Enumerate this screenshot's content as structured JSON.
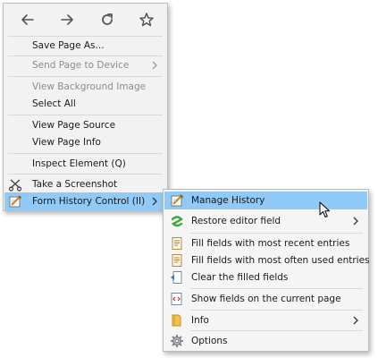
{
  "nav": {
    "back_icon": "arrow-left-icon",
    "forward_icon": "arrow-right-icon",
    "reload_icon": "reload-icon",
    "bookmark_icon": "star-icon"
  },
  "main_menu": {
    "save_page_as": "Save Page As...",
    "send_page_to_device": "Send Page to Device",
    "view_background_image": "View Background Image",
    "select_all": "Select All",
    "view_page_source": "View Page Source",
    "view_page_info": "View Page Info",
    "inspect_element": "Inspect Element (Q)",
    "take_screenshot": "Take a Screenshot",
    "form_history_control": "Form History Control (II)"
  },
  "sub_menu": {
    "manage_history": "Manage History",
    "restore_editor_field": "Restore editor field",
    "fill_recent": "Fill fields with most recent entries",
    "fill_often": "Fill fields with most often used entries",
    "clear_filled": "Clear the filled fields",
    "show_fields": "Show fields on the current page",
    "info": "Info",
    "options": "Options"
  },
  "colors": {
    "menu_bg": "#f2f2f2",
    "highlight": "#91c9f7",
    "disabled_text": "#8c8c8c",
    "separator": "#d9d9d9"
  }
}
